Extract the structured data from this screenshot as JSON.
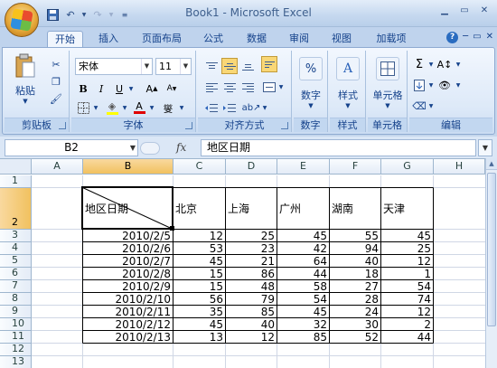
{
  "window": {
    "title": "Book1 - Microsoft Excel"
  },
  "tabs": [
    "开始",
    "插入",
    "页面布局",
    "公式",
    "数据",
    "审阅",
    "视图",
    "加载项"
  ],
  "ribbon": {
    "clipboard": {
      "label": "剪贴板",
      "paste": "粘贴"
    },
    "font": {
      "label": "字体",
      "name": "宋体",
      "size": "11"
    },
    "alignment": {
      "label": "对齐方式"
    },
    "number": {
      "label": "数字",
      "pct": "%"
    },
    "styles": {
      "label": "样式"
    },
    "cells": {
      "label": "单元格"
    },
    "editing": {
      "label": "编辑"
    }
  },
  "formula_bar": {
    "name_box": "B2",
    "fx": "fx",
    "content": "地区日期"
  },
  "sheet": {
    "columns": [
      "A",
      "B",
      "C",
      "D",
      "E",
      "F",
      "G",
      "H"
    ],
    "rows": [
      "1",
      "2",
      "3",
      "4",
      "5",
      "6",
      "7",
      "8",
      "9",
      "10",
      "11",
      "12",
      "13"
    ],
    "header": {
      "b2": "地区日期",
      "cities": [
        "北京",
        "上海",
        "广州",
        "湖南",
        "天津"
      ]
    },
    "data": [
      {
        "date": "2010/2/5",
        "values": [
          "12",
          "25",
          "45",
          "55",
          "45"
        ]
      },
      {
        "date": "2010/2/6",
        "values": [
          "53",
          "23",
          "42",
          "94",
          "25"
        ]
      },
      {
        "date": "2010/2/7",
        "values": [
          "45",
          "21",
          "64",
          "40",
          "12"
        ]
      },
      {
        "date": "2010/2/8",
        "values": [
          "15",
          "86",
          "44",
          "18",
          "1"
        ]
      },
      {
        "date": "2010/2/9",
        "values": [
          "15",
          "48",
          "58",
          "27",
          "54"
        ]
      },
      {
        "date": "2010/2/10",
        "values": [
          "56",
          "79",
          "54",
          "28",
          "74"
        ]
      },
      {
        "date": "2010/2/11",
        "values": [
          "35",
          "85",
          "45",
          "24",
          "12"
        ]
      },
      {
        "date": "2010/2/12",
        "values": [
          "45",
          "40",
          "32",
          "30",
          "2"
        ]
      },
      {
        "date": "2010/2/13",
        "values": [
          "13",
          "12",
          "85",
          "52",
          "44"
        ]
      }
    ]
  }
}
